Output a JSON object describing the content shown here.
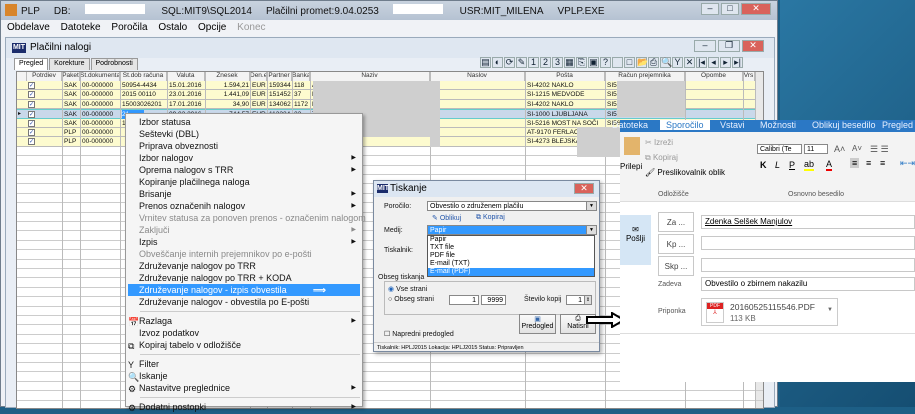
{
  "app": {
    "title_prefix": "PLP",
    "db_label": "DB:",
    "server": "SQL:MIT9\\SQL2014",
    "module": "Plačilni promet:9.04.0253",
    "user": "USR:MIT_MILENA",
    "exe": "VPLP.EXE"
  },
  "menubar": {
    "items": [
      "Obdelave",
      "Datoteke",
      "Poročila",
      "Ostalo",
      "Opcije"
    ],
    "disabled": "Konec"
  },
  "child": {
    "logo": "MIT",
    "title": "Plačilni nalogi",
    "tabs": [
      "Pregled",
      "Korekture",
      "Podrobnosti"
    ],
    "toolbar": [
      "▤",
      "◐",
      "⟳",
      "✎",
      "1",
      "2",
      "3",
      "▦",
      "⎘",
      "▣",
      "?",
      " ",
      "□",
      "📂",
      "⎙",
      "🔍",
      "Y",
      "✕",
      "|◂",
      "◂",
      "▸",
      "▸|"
    ]
  },
  "grid": {
    "columns": [
      "Potrdiev",
      "Paket",
      "Št.dokumenta",
      "Št.dob računa",
      "Valuta",
      "Znesek",
      "Den.enota",
      "Partner",
      "Banka",
      "Naziv",
      "Naslov",
      "Pošta",
      "Račun prejemnika",
      "Opombe",
      "Vrs"
    ],
    "rows": [
      {
        "paket": "SAK",
        "dok": "00-000000",
        "dob": "50954-4434",
        "valuta": "15.01.2016",
        "znesek": "1.594,21",
        "den": "EUR",
        "partner": "159344",
        "banka": "118",
        "naziv": "A",
        "naslov": "U",
        "posta": "SI-4202 NAKLO",
        "racun": "SI56 5"
      },
      {
        "paket": "SAK",
        "dok": "00-000000",
        "dob": "2015 00110",
        "valuta": "23.01.2016",
        "znesek": "1.441,09",
        "den": "EUR",
        "partner": "151452",
        "banka": "37",
        "naziv": "H",
        "naslov": "D",
        "posta": "SI-1215 MEDVODE",
        "racun": "SI56 1"
      },
      {
        "paket": "SAK",
        "dok": "00-000000",
        "dob": "15003026201",
        "valuta": "17.01.2016",
        "znesek": "34,90",
        "den": "EUR",
        "partner": "134062",
        "banka": "1172",
        "naziv": "H",
        "naslov": "G",
        "posta": "SI-4202 NAKLO",
        "racun": "SI56 3"
      },
      {
        "paket": "SAK",
        "dok": "00-000000",
        "dob": "21",
        "valuta": "09.02.2016",
        "znesek": "744,57",
        "den": "EUR",
        "partner": "113224",
        "banka": "22",
        "naziv": "T",
        "naslov": "D",
        "posta": "SI-1000 LJUBLJANA",
        "racun": "SI56 2"
      },
      {
        "paket": "SAK",
        "dok": "00-000000",
        "dob": "15",
        "valuta": "",
        "znesek": "",
        "den": "",
        "partner": "",
        "banka": "",
        "naziv": "",
        "naslov": "P",
        "posta": "SI-5216 MOST NA SOČI",
        "racun": "SI56 0"
      },
      {
        "paket": "PLP",
        "dok": "00-000000",
        "dob": "",
        "valuta": "",
        "znesek": "",
        "den": "",
        "partner": "",
        "banka": "",
        "naziv": "E",
        "naslov": "G",
        "posta": "AT-9170 FERLACH",
        "racun": "AT32 3"
      },
      {
        "paket": "PLP",
        "dok": "00-000000",
        "dob": "",
        "valuta": "",
        "znesek": "",
        "den": "",
        "partner": "",
        "banka": "",
        "naziv": "",
        "naslov": "K",
        "posta": "SI-4273 BLEJSKA DOBRAVA",
        "racun": "SI56 0"
      }
    ]
  },
  "context_menu": {
    "items": [
      {
        "label": "Izbor statusa"
      },
      {
        "label": "Seštevki (DBL)"
      },
      {
        "label": "Priprava obveznosti"
      },
      {
        "label": "Izbor nalogov",
        "sub": true
      },
      {
        "label": "Oprema nalogov s TRR",
        "sub": true
      },
      {
        "label": "Kopiranje plačilnega naloga"
      },
      {
        "label": "Brisanje",
        "sub": true
      },
      {
        "label": "Prenos označenih nalogov",
        "sub": true
      },
      {
        "label": "Vrnitev statusa za ponoven prenos - označenim nalogom",
        "disabled": true
      },
      {
        "label": "Zaključi",
        "sub": true,
        "disabled": true
      },
      {
        "label": "Izpis",
        "sub": true
      },
      {
        "label": "Obveščanje internih prejemnikov po e-pošti",
        "disabled": true
      },
      {
        "label": "Združevanje nalogov po TRR"
      },
      {
        "label": "Združevanje nalogov po TRR + KODA"
      },
      {
        "label": "Združevanje nalogov - izpis obvestila",
        "highlighted": true
      },
      {
        "label": "Združevanje nalogov - obvestila po E-pošti"
      }
    ],
    "group2": [
      {
        "label": "Razlaga",
        "sub": true,
        "icon": "📅"
      },
      {
        "label": "Izvoz podatkov"
      },
      {
        "label": "Kopiraj tabelo v odložišče",
        "icon": "⧉"
      }
    ],
    "group3": [
      {
        "label": "Filter",
        "icon": "Y"
      },
      {
        "label": "Iskanje",
        "icon": "🔍"
      },
      {
        "label": "Nastavitve preglednice",
        "sub": true,
        "icon": "⚙"
      }
    ],
    "group4": [
      {
        "label": "Dodatni postopki",
        "sub": true,
        "icon": "⚙"
      }
    ]
  },
  "dialog": {
    "logo": "MIT",
    "title": "Tiskanje",
    "report_label": "Poročilo:",
    "report_value": "Obvestilo o združenem plačilu",
    "design_link": "Oblikuj",
    "copy_link": "Kopiraj",
    "medium_label": "Medij:",
    "medium_value": "Papir",
    "medium_options": [
      "Papir",
      "TXT file",
      "PDF file",
      "E-mail (TXT)",
      "E-mail (PDF)"
    ],
    "medium_highlighted": "E-mail (PDF)",
    "printer_label": "Tiskalnik:",
    "range_label": "Obseg tiskanja",
    "all_pages": "Vse strani",
    "page_range": "Obseg strani",
    "from": "1",
    "to": "9999",
    "copies_label": "Število kopij",
    "copies": "1",
    "advanced_preview": "Napredni predogled",
    "preview_button": "Predogled",
    "print_button": "Natisni",
    "status": "Tiskalnik: HPLJ2015   Lokacija: HPLJ2015   Status: Pripravljen"
  },
  "outlook": {
    "tabs": [
      "Datoteka",
      "Sporočilo",
      "Vstavi",
      "Možnosti",
      "Oblikuj besedilo",
      "Pregled"
    ],
    "active_tab": "Sporočilo",
    "clipboard": {
      "paste": "Prilepi",
      "cut": "Izreži",
      "copy": "Kopiraj",
      "format_painter": "Preslikovalnik oblik",
      "group": "Odložišče"
    },
    "font": {
      "name": "Calibri (Te",
      "size": "11",
      "bold": "K",
      "italic": "L",
      "underline": "P",
      "group": "Osnovno besedilo"
    },
    "send": "Pošlji",
    "to_button": "Za ...",
    "cc_button": "Kp ...",
    "bcc_button": "Skp ...",
    "to_value": "Zdenka Selšek Manjulov",
    "subject_label": "Zadeva",
    "subject": "Obvestilo o zbirnem nakazilu",
    "attachment_label": "Priponka",
    "attachment_name": "20160525115546.PDF",
    "attachment_size": "113 KB"
  },
  "colors": {
    "highlight": "#3399ff",
    "row_yellow": "#fdfbcf",
    "outlook_blue": "#2b78c5"
  }
}
